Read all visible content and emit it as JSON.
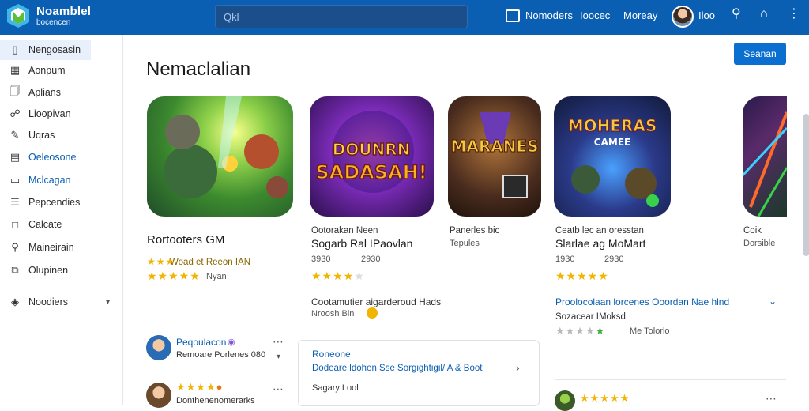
{
  "app": {
    "name": "Noamblel",
    "subtitle": "bocencen"
  },
  "search": {
    "placeholder": "Qkl"
  },
  "topnav": {
    "item1": "Nomoders",
    "item2": "Ioocec",
    "item3": "Moreay",
    "user_label": "Iloo"
  },
  "sidebar": {
    "items": [
      {
        "label": "Nengosasin",
        "icon": "phone-icon"
      },
      {
        "label": "Aonpum",
        "icon": "grid-icon"
      },
      {
        "label": "Aplians",
        "icon": "doc-icon"
      },
      {
        "label": "Lioopivan",
        "icon": "lock-icon"
      },
      {
        "label": "Uqras",
        "icon": "pencil-icon"
      },
      {
        "label": "Oeleosone",
        "icon": "calendar-icon"
      },
      {
        "label": "Mclcagan",
        "icon": "book-icon"
      },
      {
        "label": "Pepcendies",
        "icon": "list-icon"
      },
      {
        "label": "Calcate",
        "icon": "square-icon"
      },
      {
        "label": "Maineirain",
        "icon": "search-icon"
      },
      {
        "label": "Olupinen",
        "icon": "copy-icon"
      },
      {
        "label": "Noodiers",
        "icon": "tag-icon"
      }
    ]
  },
  "main": {
    "title": "Nemaclalian",
    "action_button": "Seanan",
    "games": [
      {
        "title": "Rortooters GM",
        "rating_line": "Woad et Reeon IAN",
        "reviews": "Nyan",
        "tile_text": ""
      },
      {
        "title_line1": "Ootorakan Neen",
        "title_line2": "Sogarb Ral IPaovlan",
        "count1": "3930",
        "count2": "2930",
        "tile_text_1": "DOUNRN",
        "tile_text_2": "SADASAH!"
      },
      {
        "title": "Panerles bic",
        "sub": "Tepules",
        "tile_text": "MARANES"
      },
      {
        "title_line1": "Ceatb lec an oresstan",
        "title_line2": "Slarlae ag MoMart",
        "count1": "1930",
        "count2": "2930",
        "tile_text_1": "MOHERAS",
        "tile_text_2": "CAMEE"
      },
      {
        "title": "Coik",
        "sub": "Dorsible"
      }
    ],
    "promo": {
      "text": "Cootamutier aigarderoud Hads",
      "sub": "Nroosh Bin"
    },
    "right_link": "Proolocolaan lorcenes Ooordan Nae hlnd",
    "right_sub": "Sozacear IMoksd",
    "right_meta": "Me Tolorlo",
    "user1": {
      "name": "Peqoulacon",
      "sub": "Remoare Porlenes 080"
    },
    "user2": {
      "name": "",
      "sub": "Donthenenomerarks"
    },
    "card": {
      "title": "Roneone",
      "body": "Dodeare ldohen Sse Sorgightigil/ A & Boot",
      "meta": "Sagary Lool"
    }
  },
  "colors": {
    "topbar": "#0b5fb3",
    "accent": "#0b6fd0",
    "star": "#f1b400"
  }
}
